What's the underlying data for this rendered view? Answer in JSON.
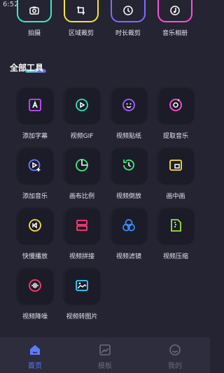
{
  "status_bar": {
    "time": "6:52"
  },
  "top_tools": [
    {
      "label": "拍摄",
      "icon": "camera-icon",
      "color": "#3de8c8"
    },
    {
      "label": "区域裁剪",
      "icon": "crop-icon",
      "color": "#f5e33b"
    },
    {
      "label": "时长裁剪",
      "icon": "clock-icon",
      "color": "#7e6cff"
    },
    {
      "label": "音乐相册",
      "icon": "music-album-icon",
      "color": "#ff4fd8"
    }
  ],
  "section": {
    "title": "全部工具"
  },
  "tools": [
    {
      "label": "添加字幕",
      "icon": "subtitle-icon",
      "color": "#c14dff"
    },
    {
      "label": "视频GIF",
      "icon": "gif-icon",
      "color": "#2ee6b8"
    },
    {
      "label": "视频贴纸",
      "icon": "sticker-icon",
      "color": "#a860ff"
    },
    {
      "label": "提取音乐",
      "icon": "extract-music-icon",
      "color": "#ff4fd8"
    },
    {
      "label": "添加音乐",
      "icon": "add-music-icon",
      "color": "#6c7cff"
    },
    {
      "label": "画布比例",
      "icon": "pie-ratio-icon",
      "color": "#3bf07a"
    },
    {
      "label": "视频倒放",
      "icon": "reverse-icon",
      "color": "#3bf07a"
    },
    {
      "label": "画中画",
      "icon": "pip-icon",
      "color": "#f5e33b"
    },
    {
      "label": "快慢播放",
      "icon": "speed-icon",
      "color": "#f5e33b"
    },
    {
      "label": "视频拼接",
      "icon": "merge-icon",
      "color": "#ff3d7a"
    },
    {
      "label": "视频滤镜",
      "icon": "filter-icon",
      "color": "#3b8cff"
    },
    {
      "label": "视频压缩",
      "icon": "compress-icon",
      "color": "#9be23b"
    },
    {
      "label": "视频降噪",
      "icon": "denoise-icon",
      "color": "#ff3d6a"
    },
    {
      "label": "视频转图片",
      "icon": "video-to-image-icon",
      "color": "#3bd0ff"
    }
  ],
  "bottom_nav": [
    {
      "label": "首页",
      "icon": "home-icon",
      "active": true
    },
    {
      "label": "模板",
      "icon": "template-icon",
      "active": false
    },
    {
      "label": "我的",
      "icon": "profile-icon",
      "active": false
    }
  ],
  "colors": {
    "background": "#242433",
    "nav_background": "#2d2d3d",
    "nav_active": "#5b7cff",
    "nav_inactive": "#6b6b7e"
  }
}
